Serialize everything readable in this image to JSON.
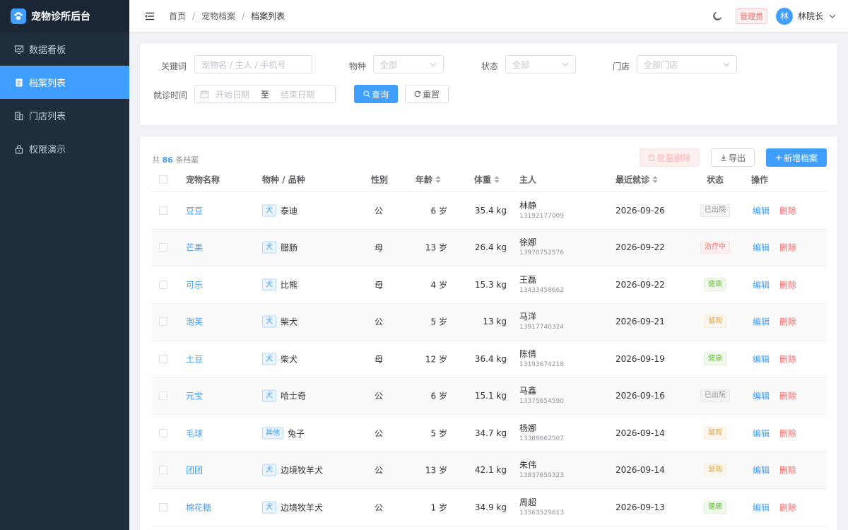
{
  "app": {
    "title": "宠物诊所后台"
  },
  "sidebar": {
    "items": [
      {
        "label": "数据看板",
        "icon": "dashboard-icon",
        "active": false
      },
      {
        "label": "档案列表",
        "icon": "document-icon",
        "active": true
      },
      {
        "label": "门店列表",
        "icon": "building-icon",
        "active": false
      },
      {
        "label": "权限演示",
        "icon": "lock-icon",
        "active": false
      }
    ]
  },
  "header": {
    "breadcrumb": [
      "首页",
      "宠物档案",
      "档案列表"
    ],
    "role": "管理员",
    "avatar_text": "林",
    "user_name": "林院长"
  },
  "filters": {
    "keyword_label": "关键词",
    "keyword_placeholder": "宠物名 / 主人 / 手机号",
    "species_label": "物种",
    "species_value": "全部",
    "status_label": "状态",
    "status_value": "全部",
    "store_label": "门店",
    "store_value": "全部门店",
    "date_label": "就诊时间",
    "date_start_placeholder": "开始日期",
    "date_sep": "至",
    "date_end_placeholder": "结束日期",
    "query_button": "查询",
    "reset_button": "重置"
  },
  "table_toolbar": {
    "count_prefix": "共",
    "count": "86",
    "count_suffix": "条档案",
    "batch_delete": "批量删除",
    "export": "导出",
    "add": "新增档案"
  },
  "table": {
    "columns": [
      "宠物名称",
      "物种 / 品种",
      "性别",
      "年龄",
      "体重",
      "主人",
      "最近就诊",
      "状态",
      "操作"
    ],
    "edit_label": "编辑",
    "delete_label": "删除",
    "rows": [
      {
        "name": "豆豆",
        "species": "犬",
        "breed": "泰迪",
        "gender": "公",
        "age": "6 岁",
        "weight": "35.4 kg",
        "owner": "林静",
        "phone": "13192177009",
        "date": "2026-09-26",
        "status": "已出院",
        "status_type": "info"
      },
      {
        "name": "芒果",
        "species": "犬",
        "breed": "腊肠",
        "gender": "母",
        "age": "13 岁",
        "weight": "26.4 kg",
        "owner": "徐娜",
        "phone": "13970752576",
        "date": "2026-09-22",
        "status": "治疗中",
        "status_type": "danger"
      },
      {
        "name": "可乐",
        "species": "犬",
        "breed": "比熊",
        "gender": "母",
        "age": "4 岁",
        "weight": "15.3 kg",
        "owner": "王磊",
        "phone": "13433458662",
        "date": "2026-09-22",
        "status": "健康",
        "status_type": "success"
      },
      {
        "name": "泡芙",
        "species": "犬",
        "breed": "柴犬",
        "gender": "公",
        "age": "5 岁",
        "weight": "13 kg",
        "owner": "马洋",
        "phone": "13917740324",
        "date": "2026-09-21",
        "status": "留观",
        "status_type": "warning"
      },
      {
        "name": "土豆",
        "species": "犬",
        "breed": "柴犬",
        "gender": "母",
        "age": "12 岁",
        "weight": "36.4 kg",
        "owner": "陈倩",
        "phone": "13193674218",
        "date": "2026-09-19",
        "status": "健康",
        "status_type": "success"
      },
      {
        "name": "元宝",
        "species": "犬",
        "breed": "哈士奇",
        "gender": "公",
        "age": "6 岁",
        "weight": "15.1 kg",
        "owner": "马鑫",
        "phone": "13375654590",
        "date": "2026-09-16",
        "status": "已出院",
        "status_type": "info"
      },
      {
        "name": "毛球",
        "species": "其他",
        "breed": "兔子",
        "gender": "公",
        "age": "5 岁",
        "weight": "34.7 kg",
        "owner": "杨娜",
        "phone": "13389662507",
        "date": "2026-09-14",
        "status": "留观",
        "status_type": "warning"
      },
      {
        "name": "团团",
        "species": "犬",
        "breed": "边境牧羊犬",
        "gender": "公",
        "age": "13 岁",
        "weight": "42.1 kg",
        "owner": "朱伟",
        "phone": "13837659323",
        "date": "2026-09-14",
        "status": "留观",
        "status_type": "warning"
      },
      {
        "name": "棉花糖",
        "species": "犬",
        "breed": "边境牧羊犬",
        "gender": "公",
        "age": "1 岁",
        "weight": "34.9 kg",
        "owner": "周超",
        "phone": "13563529813",
        "date": "2026-09-13",
        "status": "健康",
        "status_type": "success"
      }
    ]
  },
  "colors": {
    "primary": "#409eff",
    "sidebar_bg": "#1f2d3d",
    "danger": "#f56c6c",
    "success": "#67c23a",
    "warning": "#e6a23c",
    "info": "#909399"
  }
}
